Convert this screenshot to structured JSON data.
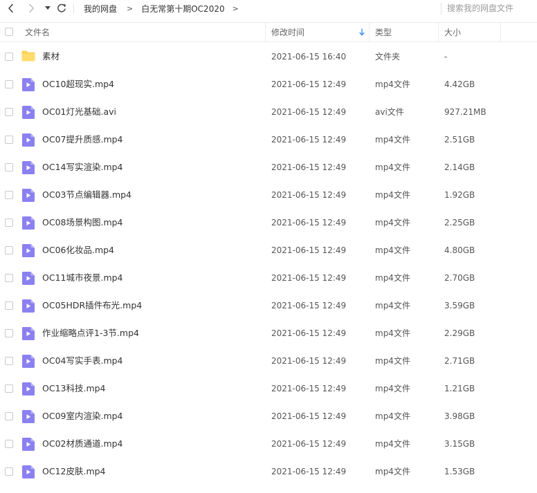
{
  "toolbar": {
    "breadcrumb": [
      "我的网盘",
      "白无常第十期OC2020"
    ],
    "breadcrumb_separator": ">",
    "search_placeholder": "搜索我的网盘文件"
  },
  "columns": {
    "name": "文件名",
    "modified": "修改时间",
    "type": "类型",
    "size": "大小"
  },
  "colors": {
    "folder": "#ffd152",
    "video_icon": "#8b80f0",
    "sort_arrow": "#3b8ef0"
  },
  "files": [
    {
      "name": "素材",
      "modified": "2021-06-15 16:40",
      "type": "文件夹",
      "size": "-",
      "icon": "folder-icon"
    },
    {
      "name": "OC10超现实.mp4",
      "modified": "2021-06-15 12:49",
      "type": "mp4文件",
      "size": "4.42GB",
      "icon": "video-file-icon"
    },
    {
      "name": "OC01灯光基础.avi",
      "modified": "2021-06-15 12:49",
      "type": "avi文件",
      "size": "927.21MB",
      "icon": "video-file-icon"
    },
    {
      "name": "OC07提升质感.mp4",
      "modified": "2021-06-15 12:49",
      "type": "mp4文件",
      "size": "2.51GB",
      "icon": "video-file-icon"
    },
    {
      "name": "OC14写实渲染.mp4",
      "modified": "2021-06-15 12:49",
      "type": "mp4文件",
      "size": "2.14GB",
      "icon": "video-file-icon"
    },
    {
      "name": "OC03节点编辑器.mp4",
      "modified": "2021-06-15 12:49",
      "type": "mp4文件",
      "size": "1.92GB",
      "icon": "video-file-icon"
    },
    {
      "name": "OC08场景构图.mp4",
      "modified": "2021-06-15 12:49",
      "type": "mp4文件",
      "size": "2.25GB",
      "icon": "video-file-icon"
    },
    {
      "name": "OC06化妆品.mp4",
      "modified": "2021-06-15 12:49",
      "type": "mp4文件",
      "size": "4.80GB",
      "icon": "video-file-icon"
    },
    {
      "name": "OC11城市夜景.mp4",
      "modified": "2021-06-15 12:49",
      "type": "mp4文件",
      "size": "2.70GB",
      "icon": "video-file-icon"
    },
    {
      "name": "OC05HDR插件布光.mp4",
      "modified": "2021-06-15 12:49",
      "type": "mp4文件",
      "size": "3.59GB",
      "icon": "video-file-icon"
    },
    {
      "name": "作业缩略点评1-3节.mp4",
      "modified": "2021-06-15 12:49",
      "type": "mp4文件",
      "size": "2.29GB",
      "icon": "video-file-icon"
    },
    {
      "name": "OC04写实手表.mp4",
      "modified": "2021-06-15 12:49",
      "type": "mp4文件",
      "size": "2.71GB",
      "icon": "video-file-icon"
    },
    {
      "name": "OC13科技.mp4",
      "modified": "2021-06-15 12:49",
      "type": "mp4文件",
      "size": "1.21GB",
      "icon": "video-file-icon"
    },
    {
      "name": "OC09室内渲染.mp4",
      "modified": "2021-06-15 12:49",
      "type": "mp4文件",
      "size": "3.98GB",
      "icon": "video-file-icon"
    },
    {
      "name": "OC02材质通道.mp4",
      "modified": "2021-06-15 12:49",
      "type": "mp4文件",
      "size": "3.15GB",
      "icon": "video-file-icon"
    },
    {
      "name": "OC12皮肤.mp4",
      "modified": "2021-06-15 12:49",
      "type": "mp4文件",
      "size": "1.53GB",
      "icon": "video-file-icon"
    }
  ]
}
